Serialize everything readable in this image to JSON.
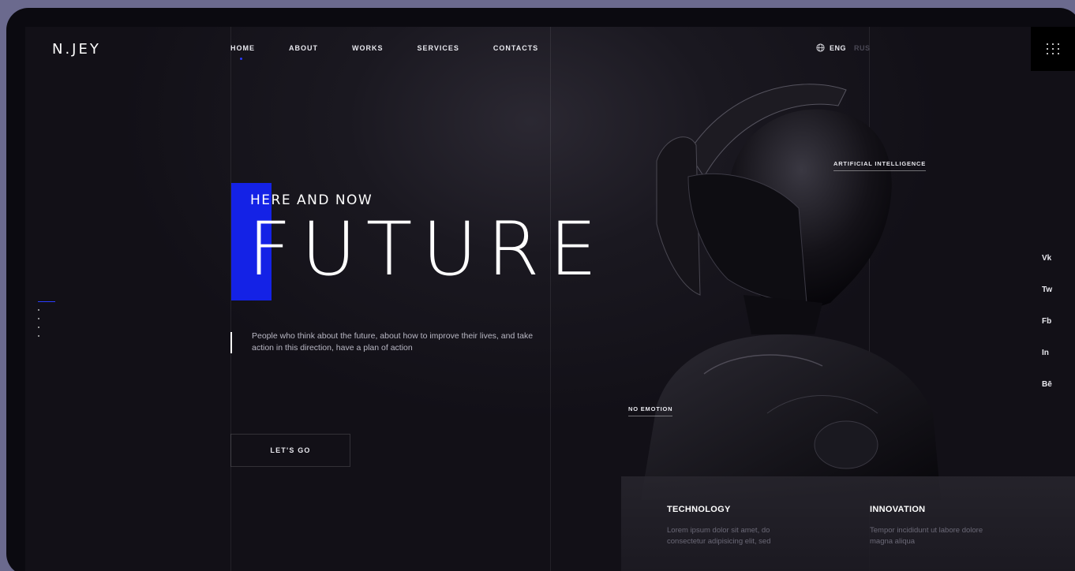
{
  "brand": {
    "logo": "N.JEY"
  },
  "nav": [
    {
      "label": "HOME",
      "active": true
    },
    {
      "label": "ABOUT"
    },
    {
      "label": "WORKS"
    },
    {
      "label": "SERVICES"
    },
    {
      "label": "CONTACTS"
    }
  ],
  "lang": {
    "current": "ENG",
    "other": "RUS",
    "icon": "globe-icon"
  },
  "menu": {
    "icon": "grid-dots-icon"
  },
  "hero": {
    "subtitle": "HERE AND NOW",
    "title": "FUTURE",
    "description": "People who think about the future, about how to improve their lives, and take action in this direction, have a plan of action",
    "cta": "LET'S GO"
  },
  "callouts": {
    "ai": "ARTIFICIAL INTELLIGENCE",
    "emotion": "NO EMOTION"
  },
  "social": [
    "Vk",
    "Tw",
    "Fb",
    "In",
    "Bē"
  ],
  "features": [
    {
      "title": "TECHNOLOGY",
      "text": "Lorem ipsum dolor sit amet, do consectetur adipisicing elit, sed"
    },
    {
      "title": "INNOVATION",
      "text": "Tempor incididunt ut labore dolore magna aliqua"
    }
  ],
  "colors": {
    "accent": "#1422e6",
    "background": "#121017",
    "text": "#ffffff"
  }
}
